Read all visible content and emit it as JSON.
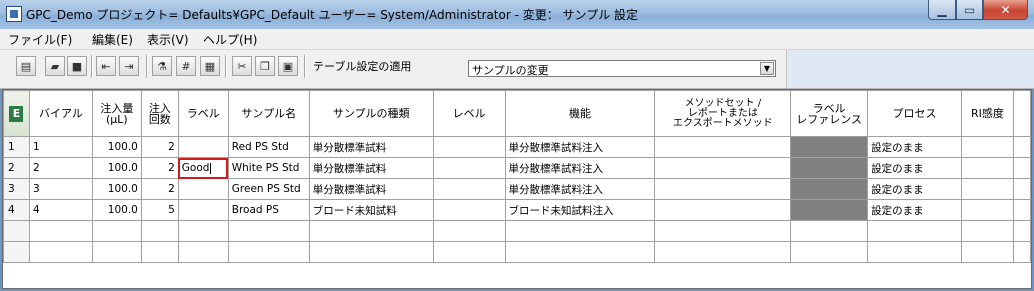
{
  "window": {
    "title": "GPC_Demo プロジェクト= Defaults¥GPC_Default ユーザー= System/Administrator - 変更： サンプル 設定"
  },
  "menu": {
    "file": "ファイル(F)",
    "edit": "編集(E)",
    "view": "表示(V)",
    "help": "ヘルプ(H)"
  },
  "toolbar": {
    "apply_label": "テーブル設定の適用",
    "apply_value": "サンプルの変更",
    "icons": [
      "new-icon",
      "open-icon",
      "save-icon",
      "insert-left-icon",
      "insert-right-icon",
      "sample-icon",
      "number-icon",
      "calculator-icon",
      "cut-icon",
      "copy-icon",
      "paste-icon"
    ]
  },
  "table": {
    "headers": {
      "corner": "E",
      "vial": "バイアル",
      "inj_vol": "注入量\n(μL)",
      "inj_count": "注入\n回数",
      "label": "ラベル",
      "sample_name": "サンプル名",
      "sample_type": "サンプルの種類",
      "level": "レベル",
      "function": "機能",
      "method_set": "メソッドセット /\nレポートまたは\nエクスポートメソッド",
      "label_ref": "ラベル\nレファレンス",
      "process": "プロセス",
      "ri_sens": "RI感度"
    },
    "rows": [
      {
        "row": "1",
        "vial": "1",
        "inj_vol": "100.0",
        "inj_count": "2",
        "label": "",
        "sample_name": "Red PS Std",
        "sample_type": "単分散標準試料",
        "level": "",
        "function": "単分散標準試料注入",
        "method_set": "",
        "process": "設定のまま",
        "ri": ""
      },
      {
        "row": "2",
        "vial": "2",
        "inj_vol": "100.0",
        "inj_count": "2",
        "label": "Good",
        "sample_name": "White PS Std",
        "sample_type": "単分散標準試料",
        "level": "",
        "function": "単分散標準試料注入",
        "method_set": "",
        "process": "設定のまま",
        "ri": ""
      },
      {
        "row": "3",
        "vial": "3",
        "inj_vol": "100.0",
        "inj_count": "2",
        "label": "",
        "sample_name": "Green PS Std",
        "sample_type": "単分散標準試料",
        "level": "",
        "function": "単分散標準試料注入",
        "method_set": "",
        "process": "設定のまま",
        "ri": ""
      },
      {
        "row": "4",
        "vial": "4",
        "inj_vol": "100.0",
        "inj_count": "5",
        "label": "",
        "sample_name": "Broad PS",
        "sample_type": "ブロード未知試料",
        "level": "",
        "function": "ブロード未知試料注入",
        "method_set": "",
        "process": "設定のまま",
        "ri": ""
      }
    ]
  }
}
